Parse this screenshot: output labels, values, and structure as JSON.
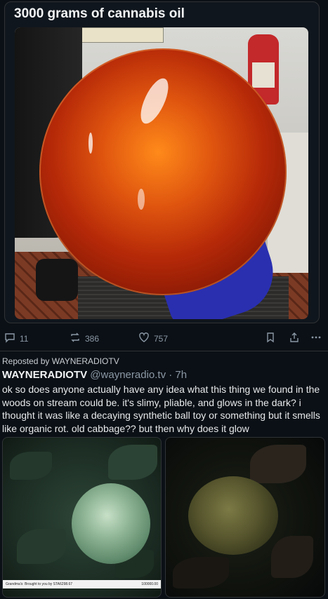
{
  "quoted_post": {
    "title": "3000 grams of cannabis oil"
  },
  "actions": {
    "replies": "11",
    "reposts": "386",
    "likes": "757"
  },
  "icons": {
    "reply": "reply-icon",
    "repost": "repost-icon",
    "like": "heart-icon",
    "bookmark": "bookmark-icon",
    "share": "share-icon",
    "more": "more-icon"
  },
  "post": {
    "reposted_by": "Reposted by WAYNERADIOTV",
    "author_name": "WAYNERADIOTV",
    "handle_time": " @wayneradio.tv · 7h",
    "text": "ok so does anyone actually have any idea what this thing we found in the woods on stream could be. it's slimy, pliable, and glows in the dark? i thought it was like a decaying synthetic ball toy or something but it smells like organic rot. old cabbage?? but then why does it glow"
  },
  "images": {
    "left_caption_left": "Grandma's: Brought to you by STA6298.67",
    "left_caption_right": "100000.00"
  },
  "colors": {
    "background": "#0b1016",
    "muted_text": "#8b98a5",
    "border": "#2f3336"
  }
}
